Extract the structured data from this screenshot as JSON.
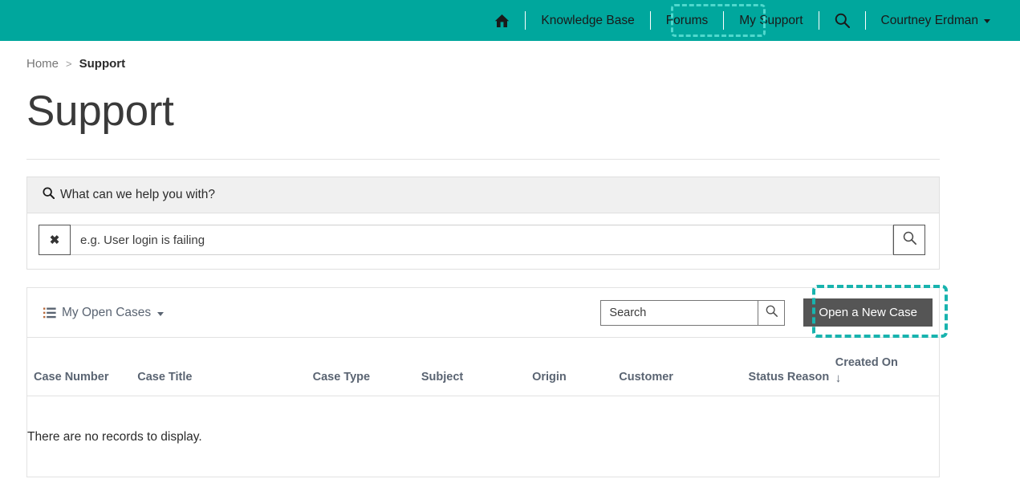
{
  "topnav": {
    "home_icon": "home-icon",
    "items": [
      {
        "label": "Knowledge Base",
        "name": "knowledge-base"
      },
      {
        "label": "Forums",
        "name": "forums"
      },
      {
        "label": "My Support",
        "name": "my-support",
        "highlighted": true
      }
    ],
    "search_icon": "search-icon",
    "user": {
      "name": "Courtney Erdman"
    },
    "background_color": "#00a79d",
    "highlight_color": "#4fd8cd"
  },
  "breadcrumb": {
    "home": "Home",
    "separator": ">",
    "current": "Support"
  },
  "page": {
    "title": "Support"
  },
  "help_search": {
    "heading": "What can we help you with?",
    "heading_icon": "search-icon",
    "clear_label": "✖",
    "input_value": "",
    "input_placeholder": "e.g. User login is failing",
    "submit_icon": "search-icon"
  },
  "cases": {
    "view_label": "My Open Cases",
    "view_icon": "list-icon",
    "search_value": "",
    "search_placeholder": "Search",
    "search_icon": "search-icon",
    "new_case_label": "Open a New Case",
    "new_case_highlight_color": "#18b3ae",
    "columns": [
      {
        "label": "Case Number",
        "sort": ""
      },
      {
        "label": "Case Title",
        "sort": ""
      },
      {
        "label": "Case Type",
        "sort": ""
      },
      {
        "label": "Subject",
        "sort": ""
      },
      {
        "label": "Origin",
        "sort": ""
      },
      {
        "label": "Customer",
        "sort": ""
      },
      {
        "label": "Status Reason",
        "sort": ""
      },
      {
        "label": "Created On",
        "sort": "↓"
      }
    ],
    "rows": [],
    "empty_message": "There are no records to display."
  }
}
